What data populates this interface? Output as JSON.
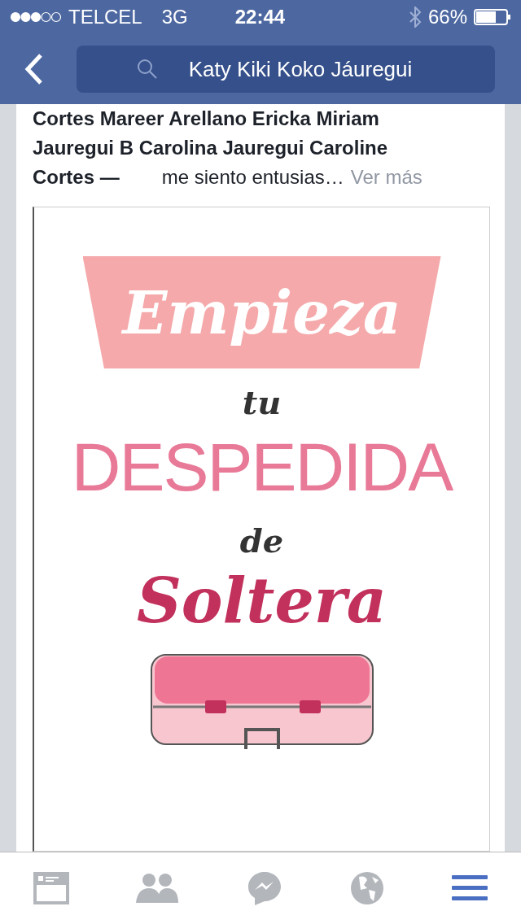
{
  "status_bar": {
    "carrier": "TELCEL",
    "network": "3G",
    "time": "22:44",
    "battery": "66%"
  },
  "nav": {
    "search": {
      "value": "Katy Kiki Koko Jáuregui"
    }
  },
  "post": {
    "lines": [
      "Cortes Mareer Arellano Ericka Miriam",
      "Jauregui B Carolina Jauregui Caroline"
    ],
    "last_names": "Cortes —",
    "status": "me siento entusias…",
    "more": "Ver más",
    "poster": {
      "banner": "Empieza",
      "small_1": "tu",
      "big": "DESPEDIDA",
      "small_2": "de",
      "script": "Soltera"
    }
  },
  "tabs": [
    {
      "kind": "news",
      "selected": false
    },
    {
      "kind": "friends",
      "selected": false
    },
    {
      "kind": "messenger",
      "selected": false
    },
    {
      "kind": "globe",
      "selected": false
    },
    {
      "kind": "menu",
      "selected": true
    }
  ]
}
